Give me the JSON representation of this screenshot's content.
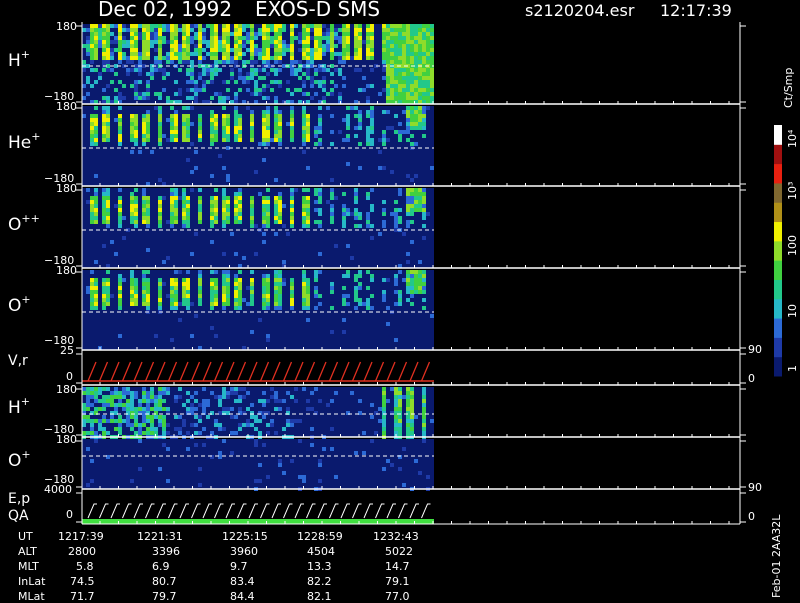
{
  "header": {
    "date": "Dec 02, 1992",
    "mission": "EXOS-D SMS",
    "file": "s2120204.esr",
    "time": "12:17:39"
  },
  "colorbar": {
    "unit": "Ct/Smp",
    "ticks": [
      "1",
      "10",
      "100",
      "10³",
      "10⁴"
    ],
    "colors": [
      "#0a1a6e",
      "#1e3aa8",
      "#2c6ad6",
      "#26b8c8",
      "#22c88a",
      "#40d040",
      "#8fdc2a",
      "#f0f000",
      "#b09018",
      "#806830",
      "#e82010",
      "#a01010",
      "#ffffff"
    ]
  },
  "panels": [
    {
      "id": "h-plus",
      "label": "H",
      "sup": "+",
      "ymax": "180",
      "ymin": "−180"
    },
    {
      "id": "he-plus",
      "label": "He",
      "sup": "+",
      "ymax": "180",
      "ymin": "−180"
    },
    {
      "id": "o-plusplus",
      "label": "O",
      "sup": "++",
      "ymax": "180",
      "ymin": "−180"
    },
    {
      "id": "o-plus",
      "label": "O",
      "sup": "+",
      "ymax": "180",
      "ymin": "−180"
    },
    {
      "id": "vr",
      "label": "V,r",
      "sup": "",
      "ymax": "25",
      "ymin": "0",
      "rmax": "90",
      "rmin": "0"
    },
    {
      "id": "h-plus-2",
      "label": "H",
      "sup": "+",
      "ymax": "180",
      "ymin": "−180"
    },
    {
      "id": "o-plus-2",
      "label": "O",
      "sup": "+",
      "ymax": "180",
      "ymin": "−180"
    },
    {
      "id": "ep",
      "label": "E,p",
      "sup": "",
      "ymax": "4000",
      "ymin": "0",
      "rmax": "90",
      "rmin": "0"
    },
    {
      "id": "qa",
      "label": "QA",
      "sup": ""
    }
  ],
  "orbit": {
    "rows": [
      {
        "label": "UT",
        "values": [
          "1217:39",
          "1221:31",
          "1225:15",
          "1228:59",
          "1232:43"
        ]
      },
      {
        "label": "ALT",
        "values": [
          "2800",
          "3396",
          "3960",
          "4504",
          "5022"
        ]
      },
      {
        "label": "MLT",
        "values": [
          "5.8",
          "6.9",
          "9.7",
          "13.3",
          "14.7"
        ]
      },
      {
        "label": "InLat",
        "values": [
          "74.5",
          "80.7",
          "83.4",
          "82.2",
          "79.1"
        ]
      },
      {
        "label": "MLat",
        "values": [
          "71.7",
          "79.7",
          "84.4",
          "82.1",
          "77.0"
        ]
      }
    ]
  },
  "footer": "Feb-01 2AA32L"
}
